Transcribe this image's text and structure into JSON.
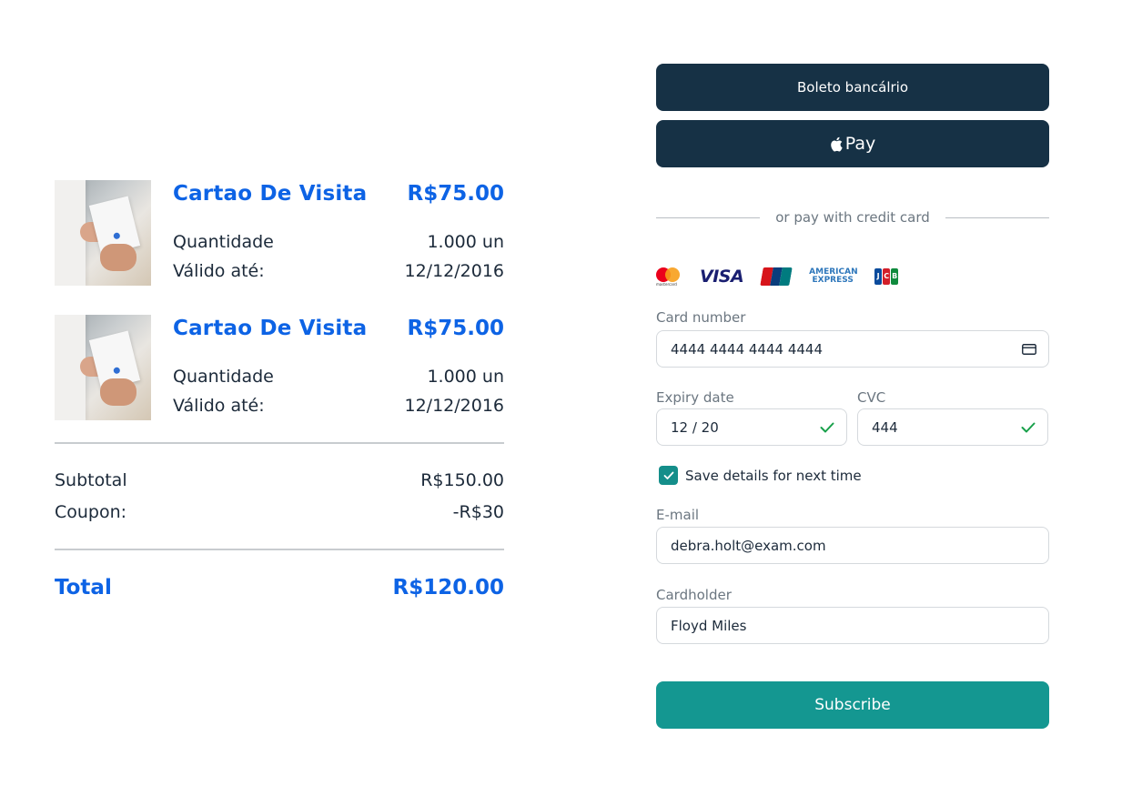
{
  "order": {
    "items": [
      {
        "name": "Cartao De Visita",
        "price": "R$75.00",
        "quantity_label": "Quantidade",
        "quantity_value": "1.000 un",
        "valid_label": "Válido até:",
        "valid_value": "12/12/2016"
      },
      {
        "name": "Cartao De Visita",
        "price": "R$75.00",
        "quantity_label": "Quantidade",
        "quantity_value": "1.000 un",
        "valid_label": "Válido até:",
        "valid_value": "12/12/2016"
      }
    ],
    "subtotal_label": "Subtotal",
    "subtotal_value": "R$150.00",
    "coupon_label": "Coupon:",
    "coupon_value": "-R$30",
    "total_label": "Total",
    "total_value": "R$120.00"
  },
  "payment": {
    "boleto_label": "Boleto bancálrio",
    "applepay_label": "Pay",
    "divider_text": "or pay with credit card",
    "brands": {
      "visa": "VISA",
      "amex": "AMERICAN EXPRESS",
      "mastercard_caption": "mastercard",
      "jcb": [
        "J",
        "C",
        "B"
      ]
    },
    "card_number_label": "Card number",
    "card_number_value": "4444 4444 4444 4444",
    "expiry_label": "Expiry date",
    "expiry_value": "12 / 20",
    "cvc_label": "CVC",
    "cvc_value": "444",
    "save_label": "Save details for next time",
    "save_checked": true,
    "email_label": "E-mail",
    "email_value": "debra.holt@exam.com",
    "cardholder_label": "Cardholder",
    "cardholder_value": "Floyd Miles",
    "submit_label": "Subscribe"
  },
  "colors": {
    "accent_blue": "#0d63e5",
    "dark_button": "#163145",
    "teal": "#149791",
    "valid_check": "#18a04a"
  }
}
